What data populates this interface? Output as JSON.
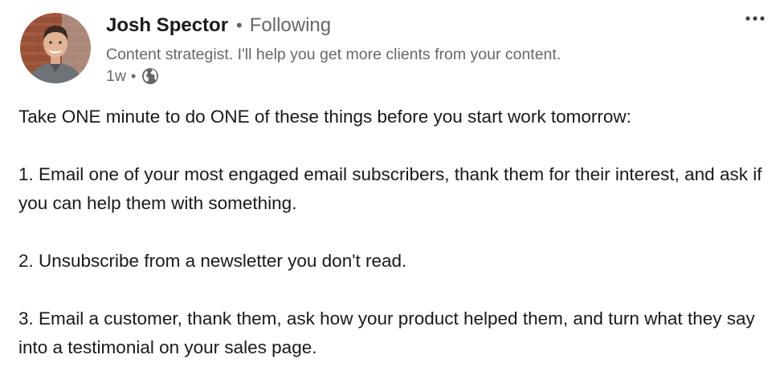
{
  "author": {
    "name": "Josh Spector",
    "follow_status": "Following",
    "headline": "Content strategist. I'll help you get more clients from your content.",
    "post_age": "1w",
    "visibility_icon": "globe-icon",
    "separator": "•"
  },
  "menu": {
    "more_icon": "ellipsis-icon"
  },
  "post": {
    "intro": "Take ONE minute to do ONE of these things before you start work tomorrow:",
    "items": [
      "1. Email one of your most engaged email subscribers, thank them for their interest, and ask if you can help them with something.",
      "2. Unsubscribe from a newsletter you don't read.",
      "3. Email a customer, thank them, ask how your product helped them, and turn what they say into a testimonial on your sales page."
    ]
  },
  "colors": {
    "text_primary": "#191919",
    "text_secondary": "#666666",
    "brick": "#8a4a36"
  }
}
